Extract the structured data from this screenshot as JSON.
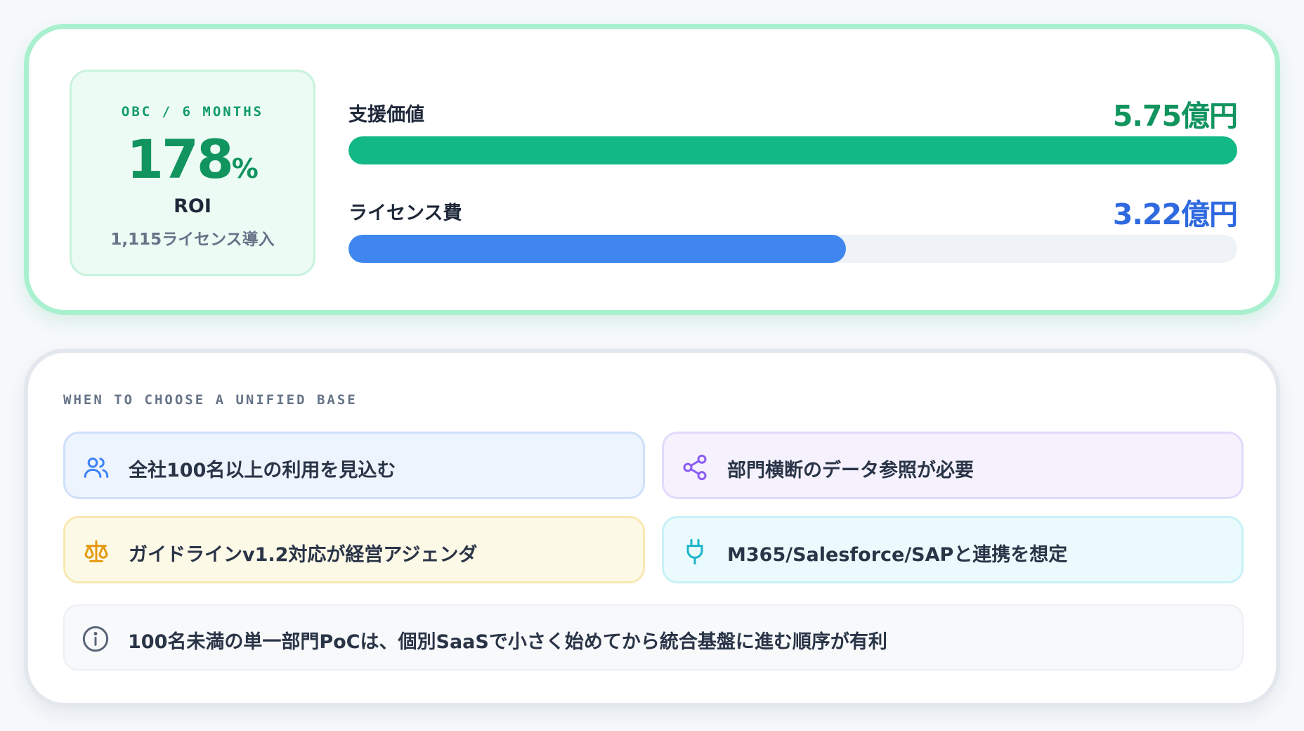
{
  "roi_card": {
    "eyebrow": "OBC / 6 MONTHS",
    "roi_value": "178",
    "roi_unit": "%",
    "roi_label": "ROI",
    "roi_sub": "1,115ライセンス導入",
    "metrics": [
      {
        "label": "支援価値",
        "value": "5.75億円",
        "fill_fraction": 1.0,
        "color": "#12b885"
      },
      {
        "label": "ライセンス費",
        "value": "3.22億円",
        "fill_fraction": 0.56,
        "color": "#3f86ee"
      }
    ]
  },
  "when_card": {
    "heading": "WHEN TO CHOOSE A UNIFIED BASE",
    "chips": [
      {
        "icon": "users-icon",
        "text": "全社100名以上の利用を見込む",
        "color": "#3b82f6"
      },
      {
        "icon": "share-icon",
        "text": "部門横断のデータ参照が必要",
        "color": "#8b5cf6"
      },
      {
        "icon": "scale-icon",
        "text": "ガイドラインv1.2対応が経営アジェンダ",
        "color": "#e59a12"
      },
      {
        "icon": "plug-icon",
        "text": "M365/Salesforce/SAPと連携を想定",
        "color": "#19b4c8"
      }
    ],
    "note": {
      "icon": "info-icon",
      "text": "100名未満の単一部門PoCは、個別SaaSで小さく始めてから統合基盤に進む順序が有利"
    }
  }
}
